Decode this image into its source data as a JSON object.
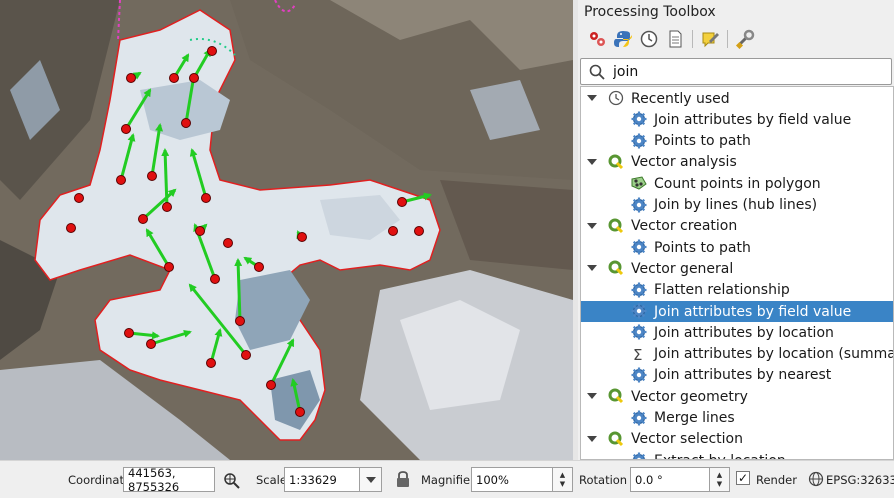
{
  "toolbox": {
    "title": "Processing Toolbox",
    "search_value": "join",
    "toolbar_icons": [
      "models-icon",
      "python-icon",
      "history-icon",
      "results-icon",
      "edit-features-icon",
      "options-icon"
    ],
    "tree": [
      {
        "kind": "group",
        "label": "Recently used",
        "icon": "clock-icon",
        "expanded": true
      },
      {
        "kind": "item",
        "label": "Join attributes by field value",
        "icon": "gear-icon"
      },
      {
        "kind": "item",
        "label": "Points to path",
        "icon": "gear-icon"
      },
      {
        "kind": "group",
        "label": "Vector analysis",
        "icon": "qgis-icon",
        "expanded": true
      },
      {
        "kind": "item",
        "label": "Count points in polygon",
        "icon": "points-icon"
      },
      {
        "kind": "item",
        "label": "Join by lines (hub lines)",
        "icon": "gear-icon"
      },
      {
        "kind": "group",
        "label": "Vector creation",
        "icon": "qgis-icon",
        "expanded": true
      },
      {
        "kind": "item",
        "label": "Points to path",
        "icon": "gear-icon"
      },
      {
        "kind": "group",
        "label": "Vector general",
        "icon": "qgis-icon",
        "expanded": true
      },
      {
        "kind": "item",
        "label": "Flatten relationship",
        "icon": "gear-icon"
      },
      {
        "kind": "item",
        "label": "Join attributes by field value",
        "icon": "gear-icon",
        "selected": true
      },
      {
        "kind": "item",
        "label": "Join attributes by location",
        "icon": "gear-icon"
      },
      {
        "kind": "item",
        "label": "Join attributes by location (summary)",
        "icon": "sigma-icon"
      },
      {
        "kind": "item",
        "label": "Join attributes by nearest",
        "icon": "gear-icon"
      },
      {
        "kind": "group",
        "label": "Vector geometry",
        "icon": "qgis-icon",
        "expanded": true
      },
      {
        "kind": "item",
        "label": "Merge lines",
        "icon": "gear-icon"
      },
      {
        "kind": "group",
        "label": "Vector selection",
        "icon": "qgis-icon",
        "expanded": true
      },
      {
        "kind": "item",
        "label": "Extract by location",
        "icon": "gear-icon"
      }
    ]
  },
  "statusbar": {
    "coordinate_label": "Coordinate",
    "coordinate_value": "441563, 8755326",
    "scale_label": "Scale",
    "scale_value": "1:33629",
    "magnifier_label": "Magnifier",
    "magnifier_value": "100%",
    "rotation_label": "Rotation",
    "rotation_value": "0.0 °",
    "render_label": "Render",
    "render_checked": true,
    "crs_label": "EPSG:32633"
  },
  "colors": {
    "selection": "#3a84c6",
    "glacier_outline": "#e02020",
    "arrow": "#22cc22",
    "point": "#e01010"
  }
}
